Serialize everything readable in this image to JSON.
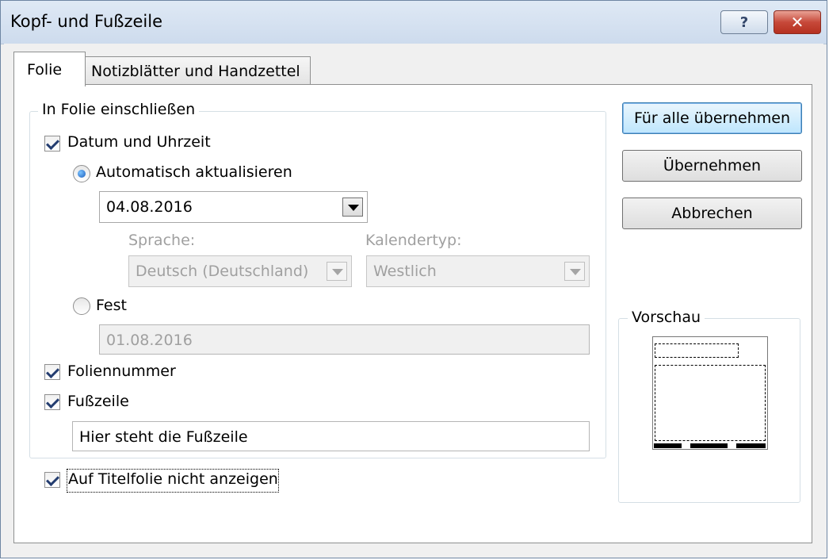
{
  "window": {
    "title": "Kopf- und Fußzeile",
    "help_label": "?",
    "close_label": "✕"
  },
  "tabs": [
    {
      "label": "Folie"
    },
    {
      "label": "Notizblätter und Handzettel"
    }
  ],
  "include_group": {
    "label": "In Folie einschließen",
    "date_time": {
      "label": "Datum und Uhrzeit",
      "checked": true
    },
    "auto_update": {
      "label": "Automatisch aktualisieren",
      "selected": true,
      "value": "04.08.2016"
    },
    "language": {
      "label": "Sprache:",
      "value": "Deutsch (Deutschland)"
    },
    "calendar": {
      "label": "Kalendertyp:",
      "value": "Westlich"
    },
    "fixed": {
      "label": "Fest",
      "selected": false,
      "value": "01.08.2016"
    },
    "slide_number": {
      "label": "Foliennummer",
      "checked": true
    },
    "footer": {
      "label": "Fußzeile",
      "checked": true,
      "value": "Hier steht die Fußzeile"
    }
  },
  "hide_title": {
    "label": "Auf Titelfolie nicht anzeigen",
    "checked": true
  },
  "buttons": {
    "apply_all": "Für alle übernehmen",
    "apply": "Übernehmen",
    "cancel": "Abbrechen"
  },
  "preview": {
    "label": "Vorschau"
  }
}
